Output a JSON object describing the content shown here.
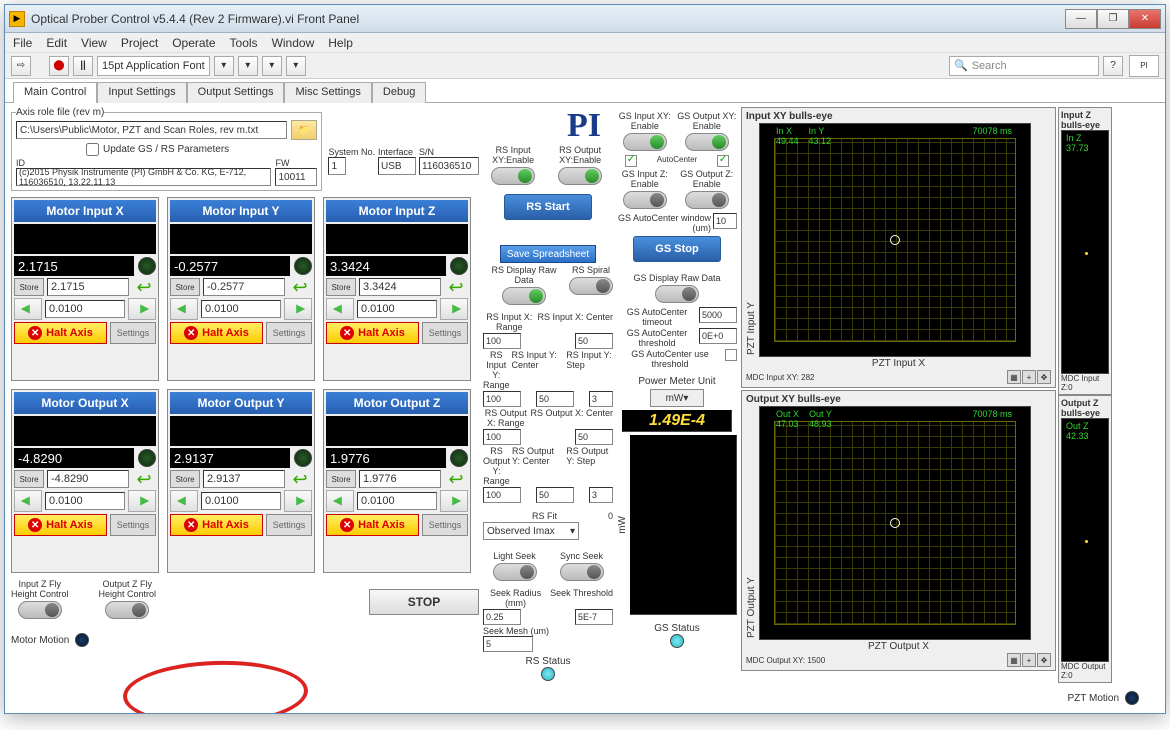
{
  "window": {
    "title": "Optical Prober Control v5.4.4 (Rev 2 Firmware).vi Front Panel"
  },
  "menu": [
    "File",
    "Edit",
    "View",
    "Project",
    "Operate",
    "Tools",
    "Window",
    "Help"
  ],
  "toolbar": {
    "font": "15pt Application Font",
    "search_placeholder": "Search"
  },
  "tabs": [
    "Main Control",
    "Input Settings",
    "Output Settings",
    "Misc Settings",
    "Debug"
  ],
  "axisfile": {
    "legend": "Axis role file   (rev m)",
    "path": "C:\\Users\\Public\\Motor, PZT and Scan Roles, rev m.txt",
    "update_label": "Update GS / RS Parameters",
    "id_label": "ID",
    "id": "(c)2015 Physik Instrumente (PI) GmbH & Co. KG, E-712, 116036510, 13.22.11.13",
    "fw_label": "FW",
    "fw": "10011",
    "sysno_label": "System No.",
    "sysno": "1",
    "iface_label": "Interface",
    "iface": "USB",
    "sn_label": "S/N",
    "sn": "116036510"
  },
  "logo": "PI",
  "motors": [
    {
      "title": "Motor Input X",
      "val": "2.1715",
      "stored": "2.1715",
      "step": "0.0100"
    },
    {
      "title": "Motor Input Y",
      "val": "-0.2577",
      "stored": "-0.2577",
      "step": "0.0100"
    },
    {
      "title": "Motor Input Z",
      "val": "3.3424",
      "stored": "3.3424",
      "step": "0.0100"
    },
    {
      "title": "Motor Output X",
      "val": "-4.8290",
      "stored": "-4.8290",
      "step": "0.0100"
    },
    {
      "title": "Motor Output Y",
      "val": "2.9137",
      "stored": "2.9137",
      "step": "0.0100"
    },
    {
      "title": "Motor Output Z",
      "val": "1.9776",
      "stored": "1.9776",
      "step": "0.0100"
    }
  ],
  "motor_common": {
    "store": "Store",
    "halt": "Halt Axis",
    "settings": "Settings"
  },
  "fly": {
    "in": "Input Z Fly\nHeight Control",
    "out": "Output Z Fly\nHeight Control"
  },
  "motion_label": "Motor Motion",
  "stop": "STOP",
  "rs": {
    "in_enable": "RS Input XY:Enable",
    "out_enable": "RS Output XY:Enable",
    "start": "RS Start",
    "save": "Save Spreadsheet",
    "disp": "RS Display Raw Data",
    "spiral": "RS Spiral",
    "inx_range_l": "RS Input X: Range",
    "inx_range": "100",
    "inx_center_l": "RS Input X: Center",
    "inx_center": "50",
    "iny_range_l": "RS Input Y: Range",
    "iny_range": "100",
    "iny_center_l": "RS Input Y: Center",
    "iny_center": "50",
    "iny_step_l": "RS Input Y: Step",
    "iny_step": "3",
    "outx_range_l": "RS Output X: Range",
    "outx_range": "100",
    "outx_center_l": "RS Output X: Center",
    "outx_center": "50",
    "outy_range_l": "RS Output Y: Range",
    "outy_range": "100",
    "outy_center_l": "RS Output Y: Center",
    "outy_center": "50",
    "outy_step_l": "RS Output Y: Step",
    "outy_step": "3",
    "fit_l": "RS Fit",
    "fit_idx": "0",
    "fit_opt": "Observed Imax",
    "lseek": "Light Seek",
    "sseek": "Sync Seek",
    "radius_l": "Seek Radius (mm)",
    "radius": "0.25",
    "thresh_l": "Seek Threshold",
    "thresh": "5E-7",
    "mesh_l": "Seek Mesh (um)",
    "mesh": "5",
    "status": "RS Status"
  },
  "gs": {
    "inxy": "GS Input XY: Enable",
    "outxy": "GS Output XY: Enable",
    "autoc": "AutoCenter",
    "inz": "GS Input Z: Enable",
    "outz": "GS Output Z: Enable",
    "acwin_l": "GS AutoCenter window (um)",
    "acwin": "10",
    "stop": "GS Stop",
    "disp": "GS Display Raw Data",
    "acto_l": "GS AutoCenter timeout",
    "acto": "5000",
    "acth_l": "GS AutoCenter threshold",
    "acth": "0E+0",
    "acuse_l": "GS AutoCenter use threshold",
    "power_l": "Power Meter Unit",
    "power_unit": "mW",
    "power_val": "1.49E-4",
    "power_axis": "mW",
    "status": "GS Status"
  },
  "eyes": {
    "inxy_title": "Input XY bulls-eye",
    "inxy_inx": "In X",
    "inxy_inx_v": "49.44",
    "inxy_iny": "In Y",
    "inxy_iny_v": "43.12",
    "inxy_ms": "70078 ms",
    "inxy_xlab": "PZT Input X",
    "inxy_ylab": "PZT Input Y",
    "inxy_foot": "MDC Input XY:   282",
    "inz_title": "Input Z bulls-eye",
    "inz_l": "In Z",
    "inz_v": "37.73",
    "inz_foot": "MDC Input Z:0",
    "outxy_title": "Output XY bulls-eye",
    "outxy_inx": "Out X",
    "outxy_inx_v": "47.03",
    "outxy_iny": "Out Y",
    "outxy_iny_v": "48.93",
    "outxy_ms": "70078 ms",
    "outxy_xlab": "PZT Output X",
    "outxy_ylab": "PZT Output Y",
    "outxy_foot": "MDC Output XY:   1500",
    "outz_title": "Output Z bulls-eye",
    "outz_l": "Out Z",
    "outz_v": "42.33",
    "outz_foot": "MDC Output Z:0"
  },
  "pzt_motion": "PZT Motion"
}
